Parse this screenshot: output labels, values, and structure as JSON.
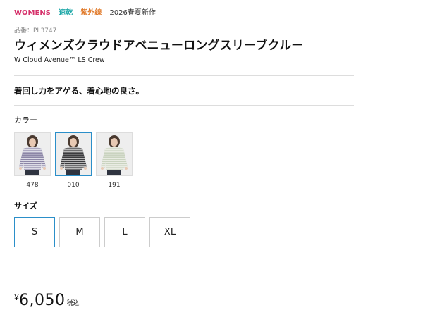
{
  "tags": {
    "category": "WOMENS",
    "feature1": "速乾",
    "feature2": "紫外線",
    "season": "2026春夏新作"
  },
  "product": {
    "number_label": "品番：PL3747",
    "title_ja": "ウィメンズクラウドアベニューロングスリーブクルー",
    "title_en": "W Cloud Avenue™ LS Crew",
    "catchcopy": "着回し力をアゲる、着心地の良さ。"
  },
  "colors": {
    "label": "カラー",
    "items": [
      {
        "code": "478",
        "selected": false,
        "main": "#8c86a6",
        "stripe": "#dcdce6"
      },
      {
        "code": "010",
        "selected": true,
        "main": "#3b3b3e",
        "stripe": "#b9b9b9"
      },
      {
        "code": "191",
        "selected": false,
        "main": "#c9d3bf",
        "stripe": "#e9ece3"
      }
    ]
  },
  "sizes": {
    "label": "サイズ",
    "items": [
      {
        "label": "S",
        "selected": true
      },
      {
        "label": "M",
        "selected": false
      },
      {
        "label": "L",
        "selected": false
      },
      {
        "label": "XL",
        "selected": false
      }
    ]
  },
  "price": {
    "currency": "¥",
    "amount": "6,050",
    "tax_note": "税込"
  }
}
